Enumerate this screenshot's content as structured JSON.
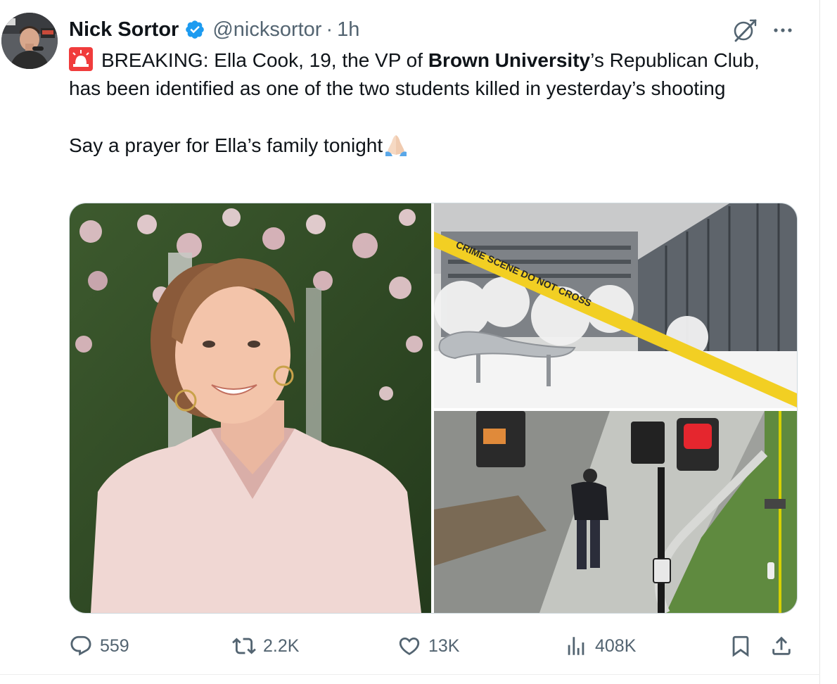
{
  "author": {
    "display_name": "Nick Sortor",
    "handle": "@nicksortor",
    "separator": "·",
    "time": "1h",
    "verified_color": "#1d9bf0"
  },
  "tweet": {
    "line1_prefix": "BREAKING: Ella Cook, 19, the VP of ",
    "line1_bold": "Brown University",
    "line1_suffix": "’s Republican Club, has been identified as one of the two students killed in yesterday’s shooting",
    "line2": "Say a prayer for Ella’s family tonight",
    "emoji_start": "siren-icon",
    "emoji_end": "folded-hands-icon"
  },
  "media": {
    "image_count": 3,
    "images": [
      "portrait-photo",
      "campus-crime-scene-photo",
      "surveillance-footage-photo"
    ]
  },
  "actions": {
    "replies": "559",
    "reposts": "2.2K",
    "likes": "13K",
    "views": "408K"
  },
  "colors": {
    "text_primary": "#0f1419",
    "text_secondary": "#536471",
    "accent": "#1d9bf0",
    "border": "#cfd9de"
  }
}
